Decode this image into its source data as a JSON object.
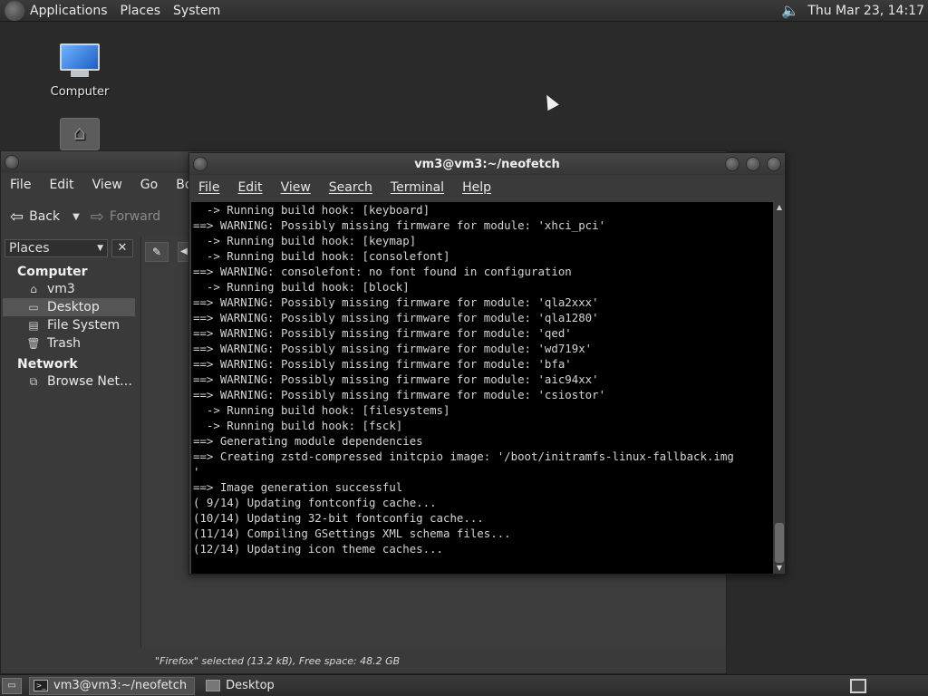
{
  "top_panel": {
    "menus": [
      "Applications",
      "Places",
      "System"
    ],
    "clock": "Thu Mar 23, 14:17",
    "volume_icon": "volume-icon"
  },
  "desktop": {
    "icons": [
      {
        "label": "Computer",
        "icon": "computer-icon"
      },
      {
        "label": "",
        "icon": "home-folder-icon"
      }
    ]
  },
  "file_manager": {
    "menus": [
      "File",
      "Edit",
      "View",
      "Go",
      "Book"
    ],
    "toolbar": {
      "back_label": "Back",
      "forward_label": "Forward"
    },
    "sidebar": {
      "selector_label": "Places",
      "sections": [
        {
          "title": "Computer",
          "items": [
            {
              "label": "vm3",
              "icon": "home-icon"
            },
            {
              "label": "Desktop",
              "icon": "desktop-icon",
              "selected": true
            },
            {
              "label": "File System",
              "icon": "drive-icon"
            },
            {
              "label": "Trash",
              "icon": "trash-icon"
            }
          ]
        },
        {
          "title": "Network",
          "items": [
            {
              "label": "Browse Net…",
              "icon": "network-icon"
            }
          ]
        }
      ]
    },
    "status": "\"Firefox\" selected (13.2 kB), Free space: 48.2 GB"
  },
  "terminal": {
    "title": "vm3@vm3:~/neofetch",
    "menus": [
      "File",
      "Edit",
      "View",
      "Search",
      "Terminal",
      "Help"
    ],
    "lines": [
      "  -> Running build hook: [keyboard]",
      "==> WARNING: Possibly missing firmware for module: 'xhci_pci'",
      "  -> Running build hook: [keymap]",
      "  -> Running build hook: [consolefont]",
      "==> WARNING: consolefont: no font found in configuration",
      "  -> Running build hook: [block]",
      "==> WARNING: Possibly missing firmware for module: 'qla2xxx'",
      "==> WARNING: Possibly missing firmware for module: 'qla1280'",
      "==> WARNING: Possibly missing firmware for module: 'qed'",
      "==> WARNING: Possibly missing firmware for module: 'wd719x'",
      "==> WARNING: Possibly missing firmware for module: 'bfa'",
      "==> WARNING: Possibly missing firmware for module: 'aic94xx'",
      "==> WARNING: Possibly missing firmware for module: 'csiostor'",
      "  -> Running build hook: [filesystems]",
      "  -> Running build hook: [fsck]",
      "==> Generating module dependencies",
      "==> Creating zstd-compressed initcpio image: '/boot/initramfs-linux-fallback.img",
      "'",
      "==> Image generation successful",
      "( 9/14) Updating fontconfig cache...",
      "(10/14) Updating 32-bit fontconfig cache...",
      "(11/14) Compiling GSettings XML schema files...",
      "(12/14) Updating icon theme caches..."
    ]
  },
  "bottom_panel": {
    "tasks": [
      {
        "label": "vm3@vm3:~/neofetch",
        "icon": "terminal-icon",
        "active": true
      },
      {
        "label": "Desktop",
        "icon": "folder-icon",
        "active": false
      }
    ]
  }
}
